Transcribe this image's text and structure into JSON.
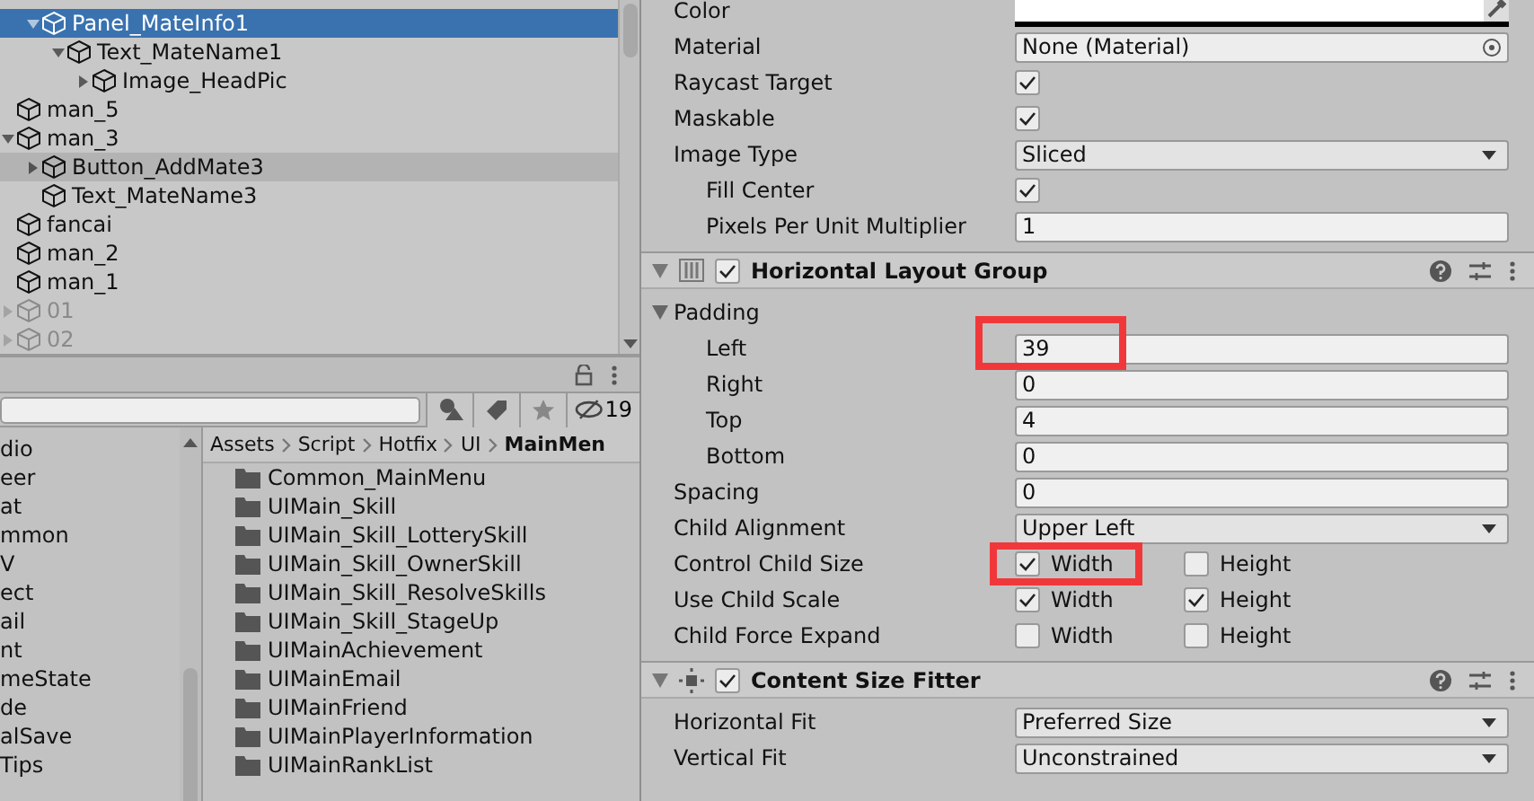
{
  "hierarchy": {
    "partial_branch": [
      {
        "name": "Panel_MateInfo1",
        "selected": true,
        "hovered": false,
        "disabled": false,
        "expanded": true,
        "children": [
          {
            "name": "Text_MateName1",
            "selected": false,
            "hovered": false,
            "disabled": false,
            "expanded": true,
            "children": [
              {
                "name": "Image_HeadPic",
                "selected": false,
                "hovered": false,
                "disabled": false,
                "expanded": false
              }
            ]
          }
        ]
      }
    ],
    "items": [
      {
        "name": "man_5",
        "selected": false,
        "hovered": false,
        "disabled": false
      },
      {
        "name": "man_3",
        "selected": false,
        "hovered": false,
        "disabled": false,
        "expanded": true,
        "children": [
          {
            "name": "Button_AddMate3",
            "selected": false,
            "hovered": true,
            "disabled": false,
            "expanded": false
          },
          {
            "name": "Text_MateName3",
            "selected": false,
            "hovered": false,
            "disabled": false
          }
        ]
      },
      {
        "name": "fancai",
        "selected": false,
        "hovered": false,
        "disabled": false
      },
      {
        "name": "man_2",
        "selected": false,
        "hovered": false,
        "disabled": false
      },
      {
        "name": "man_1",
        "selected": false,
        "hovered": false,
        "disabled": false
      },
      {
        "name": "01",
        "selected": false,
        "hovered": false,
        "disabled": true,
        "expanded": false
      },
      {
        "name": "02",
        "selected": false,
        "hovered": false,
        "disabled": true,
        "expanded": false
      }
    ]
  },
  "project": {
    "hidden_count": "19",
    "folder_tree": [
      "dio",
      "eer",
      "at",
      "mmon",
      "V",
      "ect",
      "ail",
      "nt",
      "meState",
      "de",
      "alSave",
      "Tips"
    ],
    "breadcrumb": [
      "Assets",
      "Script",
      "Hotfix",
      "UI",
      "MainMen"
    ],
    "folders": [
      "Common_MainMenu",
      "UIMain_Skill",
      "UIMain_Skill_LotterySkill",
      "UIMain_Skill_OwnerSkill",
      "UIMain_Skill_ResolveSkills",
      "UIMain_Skill_StageUp",
      "UIMainAchievement",
      "UIMainEmail",
      "UIMainFriend",
      "UIMainPlayerInformation",
      "UIMainRankList"
    ]
  },
  "inspector": {
    "image_rows": [
      {
        "kind": "color",
        "label": "Color"
      },
      {
        "kind": "object",
        "label": "Material",
        "value": "None (Material)"
      },
      {
        "kind": "checkbox",
        "label": "Raycast Target",
        "checked": true
      },
      {
        "kind": "checkbox",
        "label": "Maskable",
        "checked": true
      },
      {
        "kind": "dropdown",
        "label": "Image Type",
        "value": "Sliced",
        "children": [
          {
            "kind": "checkbox",
            "label": "Fill Center",
            "checked": true
          },
          {
            "kind": "number",
            "label": "Pixels Per Unit Multiplier",
            "value": "1"
          }
        ]
      }
    ],
    "components": [
      {
        "title": "Horizontal Layout Group",
        "enabled": true,
        "rows": [
          {
            "kind": "foldout",
            "label": "Padding",
            "expanded": true,
            "children": [
              {
                "kind": "number",
                "label": "Left",
                "value": "39",
                "annotated": true
              },
              {
                "kind": "number",
                "label": "Right",
                "value": "0"
              },
              {
                "kind": "number",
                "label": "Top",
                "value": "4"
              },
              {
                "kind": "number",
                "label": "Bottom",
                "value": "0"
              }
            ]
          },
          {
            "kind": "number",
            "label": "Spacing",
            "value": "0"
          },
          {
            "kind": "dropdown",
            "label": "Child Alignment",
            "value": "Upper Left"
          },
          {
            "kind": "pair",
            "label": "Control Child Size",
            "options": [
              {
                "label": "Width",
                "checked": true,
                "annotated": true
              },
              {
                "label": "Height",
                "checked": false
              }
            ]
          },
          {
            "kind": "pair",
            "label": "Use Child Scale",
            "options": [
              {
                "label": "Width",
                "checked": true
              },
              {
                "label": "Height",
                "checked": true
              }
            ]
          },
          {
            "kind": "pair",
            "label": "Child Force Expand",
            "options": [
              {
                "label": "Width",
                "checked": false
              },
              {
                "label": "Height",
                "checked": false
              }
            ]
          }
        ]
      },
      {
        "title": "Content Size Fitter",
        "enabled": true,
        "rows": [
          {
            "kind": "dropdown",
            "label": "Horizontal Fit",
            "value": "Preferred Size"
          },
          {
            "kind": "dropdown",
            "label": "Vertical Fit",
            "value": "Unconstrained"
          }
        ]
      }
    ]
  }
}
